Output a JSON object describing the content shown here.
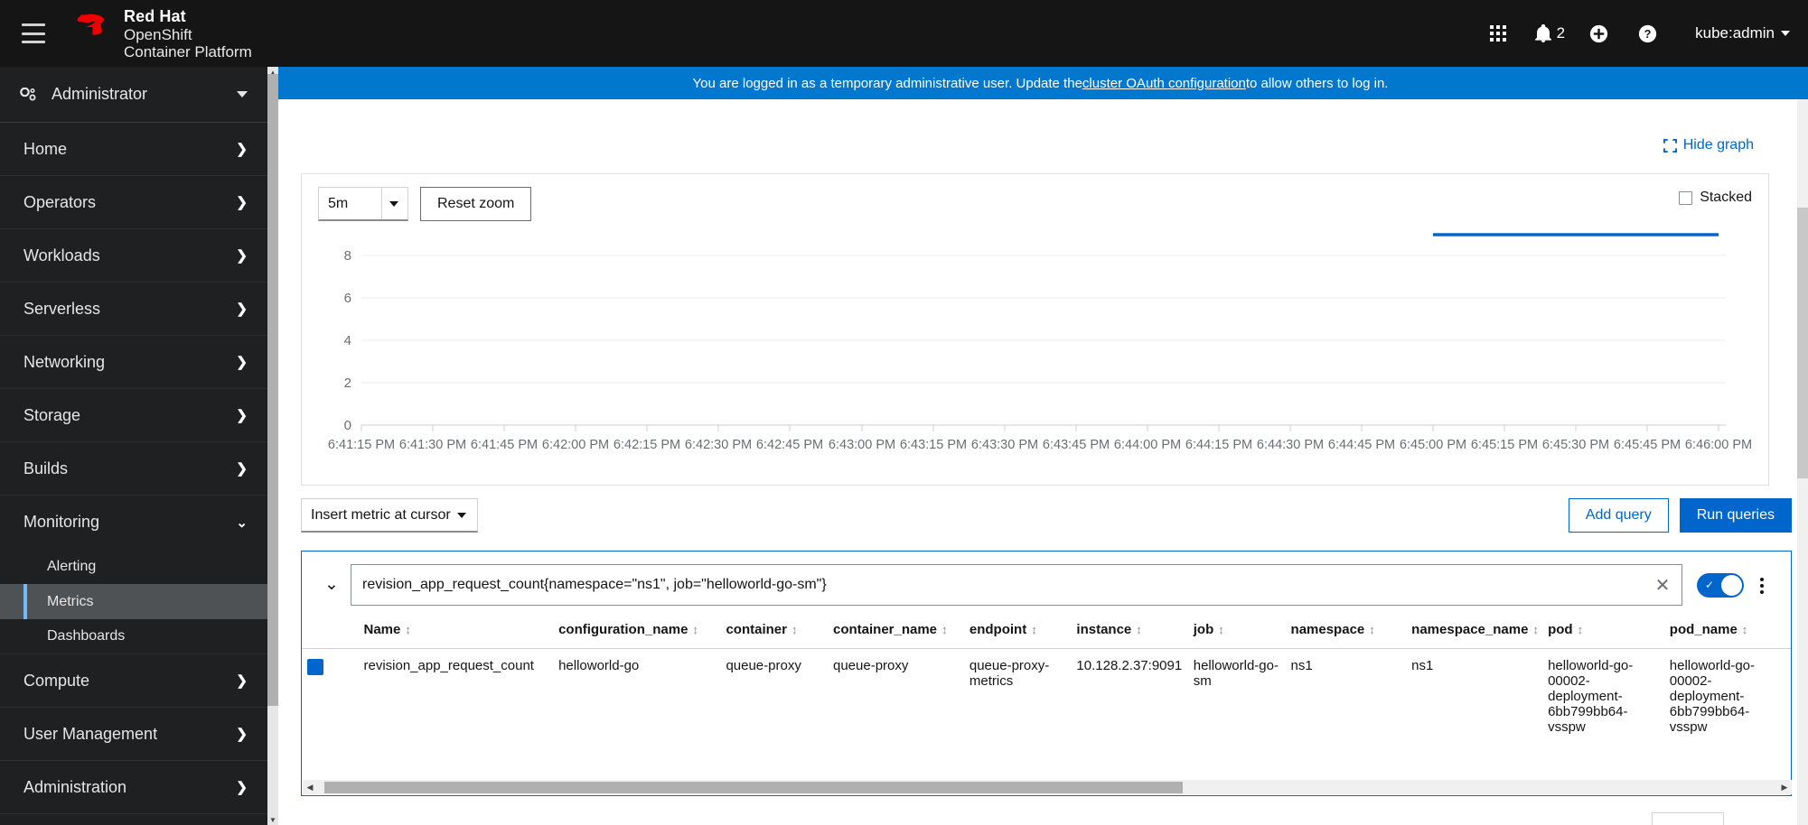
{
  "masthead": {
    "hamburger_name": "Navigation toggle",
    "brand": {
      "line1": "Red Hat",
      "line2": "OpenShift",
      "line3": "Container Platform"
    },
    "apps_icon": "grid-apps-icon",
    "notifications_icon": "bell-icon",
    "notifications_count": "2",
    "plus_icon": "plus-circle-icon",
    "help_icon": "question-circle-icon",
    "user": "kube:admin"
  },
  "banner": {
    "text_before": "You are logged in as a temporary administrative user. Update the ",
    "link": "cluster OAuth configuration",
    "text_after": " to allow others to log in."
  },
  "sidebar": {
    "perspective": "Administrator",
    "items": [
      {
        "label": "Home",
        "expandable": true
      },
      {
        "label": "Operators",
        "expandable": true
      },
      {
        "label": "Workloads",
        "expandable": true
      },
      {
        "label": "Serverless",
        "expandable": true
      },
      {
        "label": "Networking",
        "expandable": true
      },
      {
        "label": "Storage",
        "expandable": true
      },
      {
        "label": "Builds",
        "expandable": true
      },
      {
        "label": "Monitoring",
        "expandable": true,
        "expanded": true
      },
      {
        "label": "Compute",
        "expandable": true
      },
      {
        "label": "User Management",
        "expandable": true
      },
      {
        "label": "Administration",
        "expandable": true
      }
    ],
    "monitoring_children": [
      {
        "label": "Alerting",
        "active": false
      },
      {
        "label": "Metrics",
        "active": true
      },
      {
        "label": "Dashboards",
        "active": false
      }
    ]
  },
  "main": {
    "hide_graph_label": "Hide graph",
    "chart_controls": {
      "time_range": "5m",
      "reset_zoom_label": "Reset zoom",
      "stacked_label": "Stacked",
      "stacked_checked": false
    },
    "query_toolbar": {
      "insert_metric_label": "Insert metric at cursor",
      "add_query_label": "Add query",
      "run_queries_label": "Run queries"
    },
    "query": {
      "expression": "revision_app_request_count{namespace=\"ns1\", job=\"helloworld-go-sm\"}",
      "enabled": true,
      "clear_icon": "close-icon",
      "kebab_icon": "kebab-menu-icon",
      "chevron_icon": "chevron-down-icon"
    },
    "results": {
      "columns": [
        "Name",
        "configuration_name",
        "container",
        "container_name",
        "endpoint",
        "instance",
        "job",
        "namespace",
        "namespace_name",
        "pod",
        "pod_name"
      ],
      "rows": [
        {
          "color": "#0066cc",
          "Name": "revision_app_request_count",
          "configuration_name": "helloworld-go",
          "container": "queue-proxy",
          "container_name": "queue-proxy",
          "endpoint": "queue-proxy-metrics",
          "instance": "10.128.2.37:9091",
          "job": "helloworld-go-sm",
          "namespace": "ns1",
          "namespace_name": "ns1",
          "pod": "helloworld-go-00002-deployment-6bb799bb64-vsspw",
          "pod_name": "helloworld-go-00002-deployment-6bb799bb64-vsspw"
        }
      ]
    }
  },
  "chart_data": {
    "type": "line",
    "title": "",
    "xlabel": "",
    "ylabel": "",
    "ylim": [
      0,
      9
    ],
    "yticks": [
      0,
      2,
      4,
      6,
      8
    ],
    "grid": true,
    "legend": "none",
    "x": [
      "6:41:15 PM",
      "6:41:30 PM",
      "6:41:45 PM",
      "6:42:00 PM",
      "6:42:15 PM",
      "6:42:30 PM",
      "6:42:45 PM",
      "6:43:00 PM",
      "6:43:15 PM",
      "6:43:30 PM",
      "6:43:45 PM",
      "6:44:00 PM",
      "6:44:15 PM",
      "6:44:30 PM",
      "6:44:45 PM",
      "6:45:00 PM",
      "6:45:15 PM",
      "6:45:30 PM",
      "6:45:45 PM",
      "6:46:00 PM"
    ],
    "series": [
      {
        "name": "revision_app_request_count{namespace=\"ns1\", job=\"helloworld-go-sm\"}",
        "color": "#0066cc",
        "points": [
          {
            "x": "6:45:00 PM",
            "y": 9
          },
          {
            "x": "6:45:15 PM",
            "y": 9
          },
          {
            "x": "6:45:30 PM",
            "y": 9
          },
          {
            "x": "6:45:45 PM",
            "y": 9
          },
          {
            "x": "6:46:00 PM",
            "y": 9
          }
        ]
      }
    ]
  }
}
